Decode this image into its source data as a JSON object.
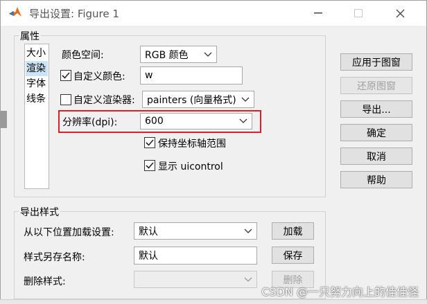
{
  "window": {
    "title": "导出设置: Figure 1",
    "controls": {
      "minimize": "minimize-icon",
      "maximize": "maximize-icon",
      "close": "close-icon"
    }
  },
  "properties": {
    "group_title": "属性",
    "categories": [
      {
        "label": "大小",
        "selected": false
      },
      {
        "label": "渲染",
        "selected": true
      },
      {
        "label": "字体",
        "selected": false
      },
      {
        "label": "线条",
        "selected": false
      }
    ],
    "colorspace": {
      "label": "颜色空间:",
      "value": "RGB 颜色"
    },
    "custom_color": {
      "label": "自定义颜色:",
      "checked": true,
      "value": "w"
    },
    "custom_renderer": {
      "label": "自定义渲染器:",
      "checked": false,
      "value": "painters (向量格式)"
    },
    "resolution": {
      "label": "分辨率(dpi):",
      "value": "600"
    },
    "keep_axes": {
      "label": "保持坐标轴范围",
      "checked": true
    },
    "show_uicontrol": {
      "label": "显示 uicontrol",
      "checked": true
    }
  },
  "export_styles": {
    "group_title": "导出样式",
    "load": {
      "label": "从以下位置加载设置:",
      "value": "默认",
      "button": "加载"
    },
    "save": {
      "label": "样式另存名称:",
      "value": "默认",
      "button": "保存"
    },
    "delete": {
      "label": "删除样式:",
      "value": "",
      "button": "删除"
    }
  },
  "side_buttons": {
    "apply": "应用于图窗",
    "restore": "还原图窗",
    "export": "导出...",
    "ok": "确定",
    "cancel": "取消",
    "help": "帮助"
  },
  "watermark": "CSDN @一只努力向上的佳佳怪",
  "colors": {
    "highlight": "#d8202c",
    "selection": "#cce4f7"
  }
}
